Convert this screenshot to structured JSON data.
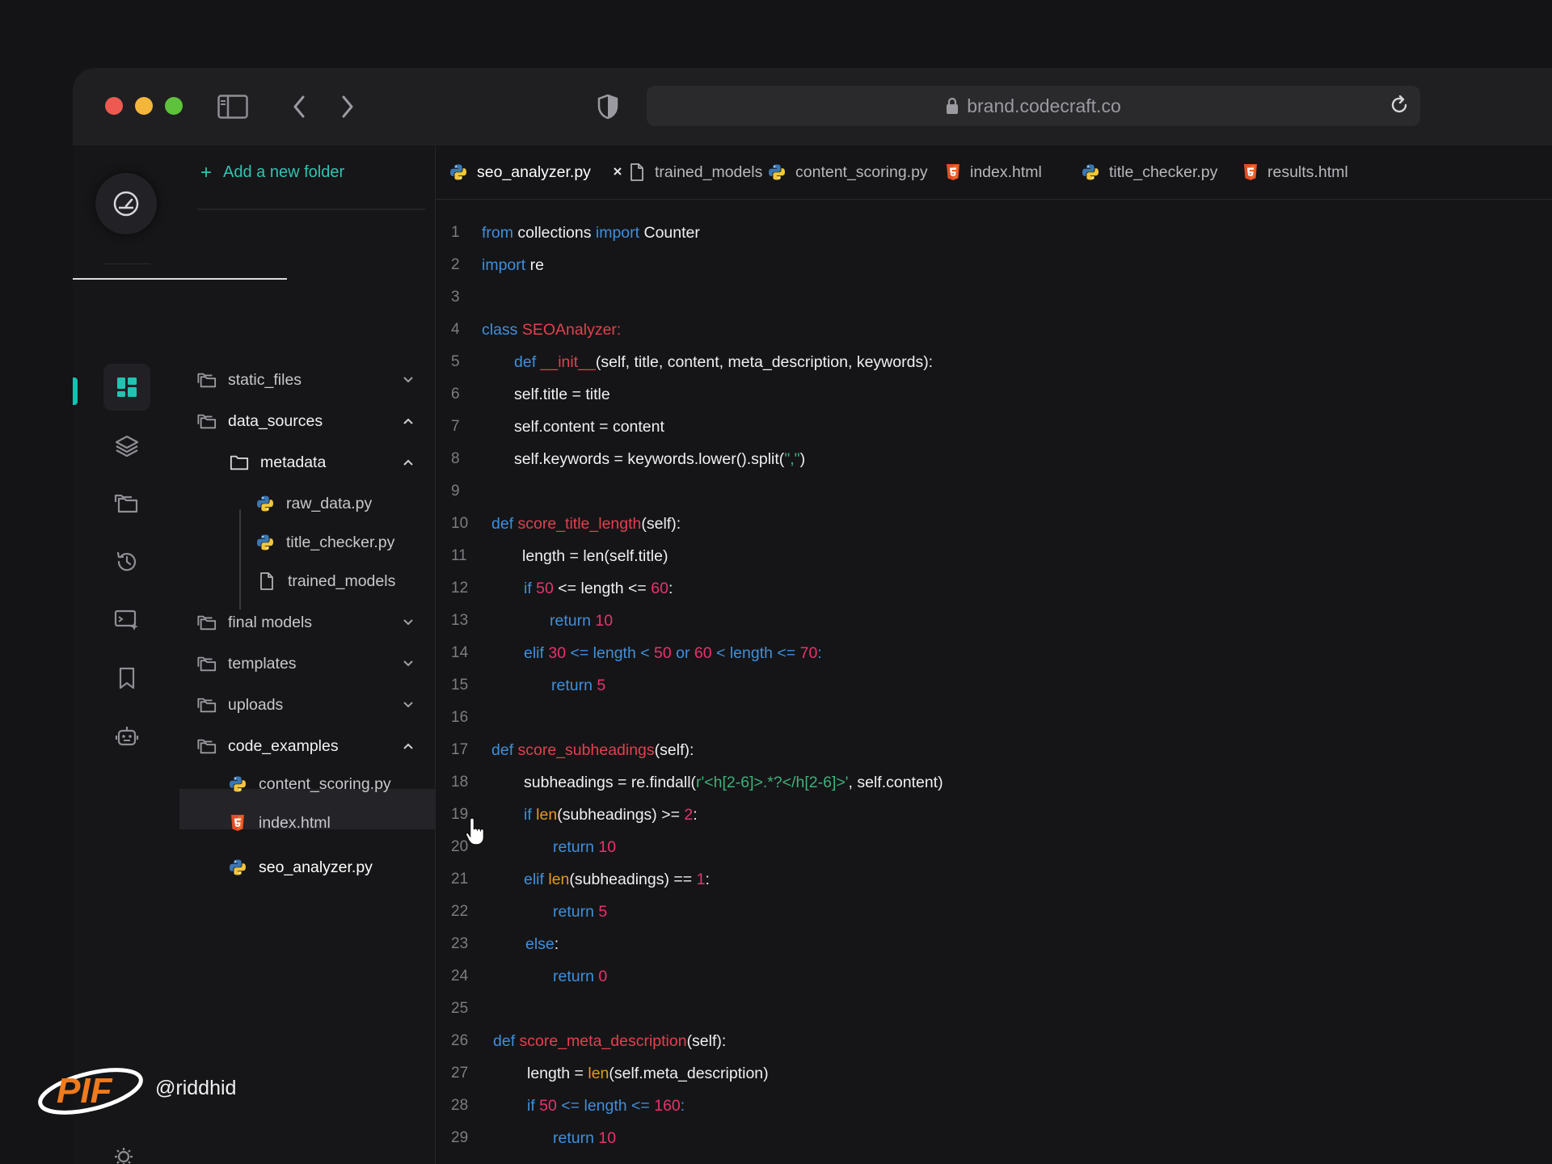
{
  "browser": {
    "url": "brand.codecraft.co"
  },
  "sidebar": {
    "add_folder": "Add a new folder",
    "items": [
      {
        "label": "static_files",
        "type": "folder",
        "expanded": false
      },
      {
        "label": "data_sources",
        "type": "folder",
        "expanded": true
      },
      {
        "label": "metadata",
        "type": "folder-open",
        "expanded": true
      },
      {
        "label": "raw_data.py",
        "type": "python"
      },
      {
        "label": "title_checker.py",
        "type": "python"
      },
      {
        "label": "trained_models",
        "type": "file"
      },
      {
        "label": "final models",
        "type": "folder",
        "expanded": false
      },
      {
        "label": "templates",
        "type": "folder",
        "expanded": false
      },
      {
        "label": "uploads",
        "type": "folder",
        "expanded": false
      },
      {
        "label": "code_examples",
        "type": "folder",
        "expanded": true
      },
      {
        "label": "content_scoring.py",
        "type": "python"
      },
      {
        "label": "index.html",
        "type": "html"
      },
      {
        "label": "seo_analyzer.py",
        "type": "python",
        "selected": true
      }
    ]
  },
  "tabs": [
    {
      "label": "seo_analyzer.py",
      "type": "python",
      "active": true
    },
    {
      "label": "trained_models",
      "type": "file"
    },
    {
      "label": "content_scoring.py",
      "type": "python"
    },
    {
      "label": "index.html",
      "type": "html"
    },
    {
      "label": "title_checker.py",
      "type": "python"
    },
    {
      "label": "results.html",
      "type": "html"
    }
  ],
  "code": [
    {
      "n": "1",
      "indent": 0,
      "tokens": [
        [
          "kw",
          "from"
        ],
        [
          "plain",
          " collections "
        ],
        [
          "kw",
          "import"
        ],
        [
          "plain",
          " Counter"
        ]
      ]
    },
    {
      "n": "2",
      "indent": 0,
      "tokens": [
        [
          "kw",
          "import"
        ],
        [
          "plain",
          " re"
        ]
      ]
    },
    {
      "n": "3",
      "indent": 0,
      "tokens": []
    },
    {
      "n": "4",
      "indent": 0,
      "tokens": [
        [
          "kw",
          "class "
        ],
        [
          "cls",
          "SEOAnalyzer:"
        ]
      ]
    },
    {
      "n": "5",
      "indent": 40,
      "tokens": [
        [
          "kw",
          "def "
        ],
        [
          "fn",
          "__init__"
        ],
        [
          "plain",
          "(self, title, content, meta_description, keywords):"
        ]
      ]
    },
    {
      "n": "6",
      "indent": 40,
      "tokens": [
        [
          "plain",
          "self.title = title"
        ]
      ]
    },
    {
      "n": "7",
      "indent": 40,
      "tokens": [
        [
          "plain",
          "self.content = content"
        ]
      ]
    },
    {
      "n": "8",
      "indent": 40,
      "tokens": [
        [
          "plain",
          "self.keywords = keywords.lower().split("
        ],
        [
          "str",
          "\",\""
        ],
        [
          "plain",
          ")"
        ]
      ]
    },
    {
      "n": "9",
      "indent": 0,
      "tokens": []
    },
    {
      "n": "10",
      "indent": 12,
      "tokens": [
        [
          "kw",
          "def "
        ],
        [
          "fn",
          "score_title_length"
        ],
        [
          "plain",
          "(self):"
        ]
      ]
    },
    {
      "n": "11",
      "indent": 50,
      "tokens": [
        [
          "plain",
          "length = len(self.title)"
        ]
      ]
    },
    {
      "n": "12",
      "indent": 52,
      "tokens": [
        [
          "kw",
          "if "
        ],
        [
          "num",
          "50"
        ],
        [
          "plain",
          " <= length <= "
        ],
        [
          "num",
          "60"
        ],
        [
          "plain",
          ":"
        ]
      ]
    },
    {
      "n": "13",
      "indent": 84,
      "tokens": [
        [
          "kw",
          "return "
        ],
        [
          "num",
          "10"
        ]
      ]
    },
    {
      "n": "14",
      "indent": 52,
      "tokens": [
        [
          "kw",
          "elif "
        ],
        [
          "num",
          "30"
        ],
        [
          "kw",
          " <= length < "
        ],
        [
          "num",
          "50"
        ],
        [
          "kw",
          " or "
        ],
        [
          "num",
          "60"
        ],
        [
          "kw",
          " < length <= "
        ],
        [
          "num",
          "70"
        ],
        [
          "kw",
          ":"
        ]
      ]
    },
    {
      "n": "15",
      "indent": 86,
      "tokens": [
        [
          "kw",
          "return "
        ],
        [
          "num",
          "5"
        ]
      ]
    },
    {
      "n": "16",
      "indent": 0,
      "tokens": []
    },
    {
      "n": "17",
      "indent": 12,
      "tokens": [
        [
          "kw",
          "def "
        ],
        [
          "fn",
          "score_subheadings"
        ],
        [
          "plain",
          "(self):"
        ]
      ]
    },
    {
      "n": "18",
      "indent": 52,
      "tokens": [
        [
          "plain",
          "subheadings = re.findall("
        ],
        [
          "str",
          "r'<h[2-6]>.*?</h[2-6]>'"
        ],
        [
          "plain",
          ", self.content)"
        ]
      ]
    },
    {
      "n": "19",
      "indent": 52,
      "tokens": [
        [
          "kw",
          "if "
        ],
        [
          "bi",
          "len"
        ],
        [
          "plain",
          "(subheadings) >= "
        ],
        [
          "num",
          "2"
        ],
        [
          "plain",
          ":"
        ]
      ]
    },
    {
      "n": "20",
      "indent": 88,
      "tokens": [
        [
          "kw",
          "return "
        ],
        [
          "num",
          "10"
        ]
      ]
    },
    {
      "n": "21",
      "indent": 52,
      "tokens": [
        [
          "kw",
          "elif "
        ],
        [
          "bi",
          "len"
        ],
        [
          "plain",
          "(subheadings) == "
        ],
        [
          "num",
          "1"
        ],
        [
          "plain",
          ":"
        ]
      ]
    },
    {
      "n": "22",
      "indent": 88,
      "tokens": [
        [
          "kw",
          "return "
        ],
        [
          "num",
          "5"
        ]
      ]
    },
    {
      "n": "23",
      "indent": 54,
      "tokens": [
        [
          "kw",
          "else"
        ],
        [
          "plain",
          ":"
        ]
      ]
    },
    {
      "n": "24",
      "indent": 88,
      "tokens": [
        [
          "kw",
          "return "
        ],
        [
          "num",
          "0"
        ]
      ]
    },
    {
      "n": "25",
      "indent": 0,
      "tokens": []
    },
    {
      "n": "26",
      "indent": 14,
      "tokens": [
        [
          "kw",
          "def "
        ],
        [
          "fn",
          "score_meta_description"
        ],
        [
          "plain",
          "(self):"
        ]
      ]
    },
    {
      "n": "27",
      "indent": 56,
      "tokens": [
        [
          "plain",
          "length = "
        ],
        [
          "bi",
          "len"
        ],
        [
          "plain",
          "(self.meta_description)"
        ]
      ]
    },
    {
      "n": "28",
      "indent": 56,
      "tokens": [
        [
          "kw",
          "if "
        ],
        [
          "num",
          "50"
        ],
        [
          "kw",
          " <= length <= "
        ],
        [
          "num",
          "160"
        ],
        [
          "kw",
          ":"
        ]
      ]
    },
    {
      "n": "29",
      "indent": 88,
      "tokens": [
        [
          "kw",
          "return "
        ],
        [
          "num",
          "10"
        ]
      ]
    }
  ],
  "watermark": {
    "logo_text": "PIF",
    "handle": "@riddhid"
  },
  "colors": {
    "accent": "#16c1b0",
    "keyword": "#3f8fdc",
    "class_name": "#e2404f",
    "number": "#e8336d",
    "string": "#3fb07a",
    "builtin": "#e69a1e"
  }
}
